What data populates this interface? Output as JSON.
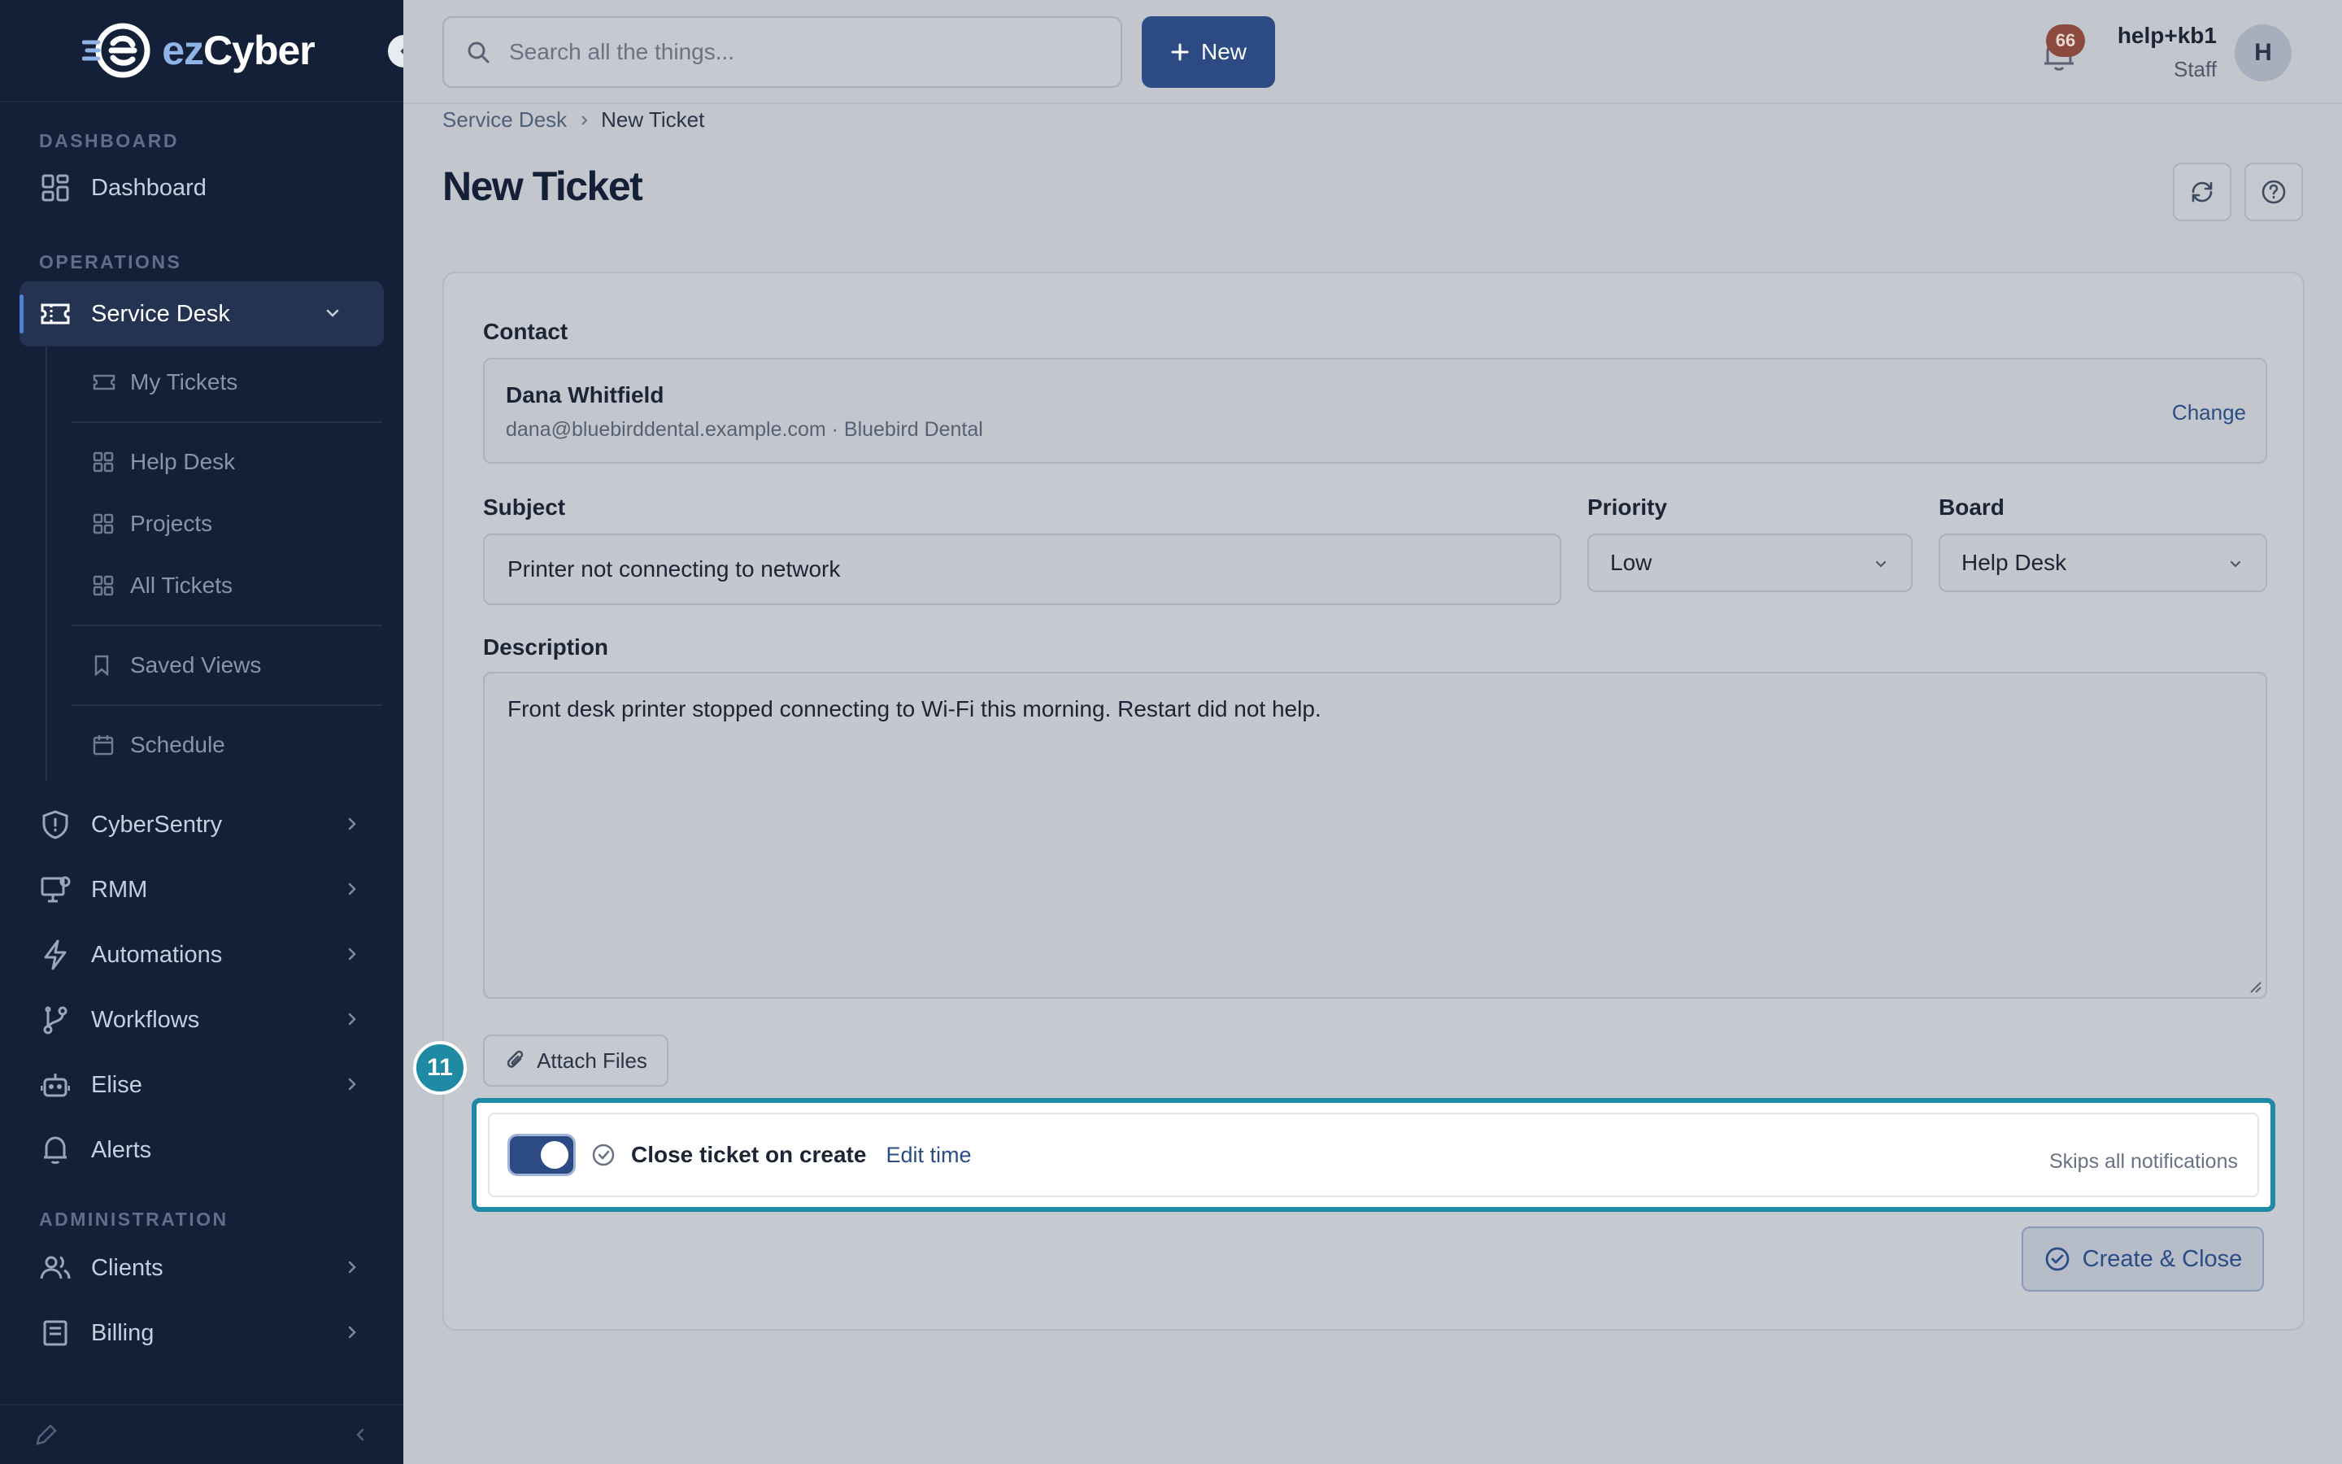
{
  "brand": {
    "logo_prefix": "ez",
    "logo_suffix": "Cyber"
  },
  "sidebar": {
    "sections": {
      "dashboard": "DASHBOARD",
      "operations": "OPERATIONS",
      "administration": "ADMINISTRATION"
    },
    "items": {
      "dashboard": "Dashboard",
      "service_desk": "Service Desk",
      "cybersentry": "CyberSentry",
      "rmm": "RMM",
      "automations": "Automations",
      "workflows": "Workflows",
      "elise": "Elise",
      "alerts": "Alerts",
      "clients": "Clients",
      "billing": "Billing"
    },
    "sub_items": {
      "my_tickets": "My Tickets",
      "help_desk": "Help Desk",
      "projects": "Projects",
      "all_tickets": "All Tickets",
      "saved_views": "Saved Views",
      "schedule": "Schedule"
    }
  },
  "topbar": {
    "search_placeholder": "Search all the things...",
    "new_label": "New",
    "notification_count": "66",
    "user_name": "help+kb1",
    "user_role": "Staff",
    "avatar_initial": "H"
  },
  "breadcrumb": {
    "parent": "Service Desk",
    "current": "New Ticket"
  },
  "page": {
    "title": "New Ticket"
  },
  "form": {
    "contact_label": "Contact",
    "contact_name": "Dana Whitfield",
    "contact_meta": "dana@bluebirddental.example.com · Bluebird Dental",
    "change_label": "Change",
    "subject_label": "Subject",
    "subject_value": "Printer not connecting to network",
    "priority_label": "Priority",
    "priority_value": "Low",
    "board_label": "Board",
    "board_value": "Help Desk",
    "description_label": "Description",
    "description_value": "Front desk printer stopped connecting to Wi-Fi this morning. Restart did not help.",
    "attach_label": "Attach Files",
    "close_on_create_label": "Close ticket on create",
    "close_on_create_enabled": true,
    "edit_time_label": "Edit time",
    "skips_note": "Skips all notifications",
    "submit_label": "Create & Close"
  },
  "annotation": {
    "step_number": "11",
    "color": "#1f8aa3"
  },
  "colors": {
    "sidebar_bg": "#142038",
    "primary": "#2c4a83",
    "accent": "#4d7fd6"
  }
}
